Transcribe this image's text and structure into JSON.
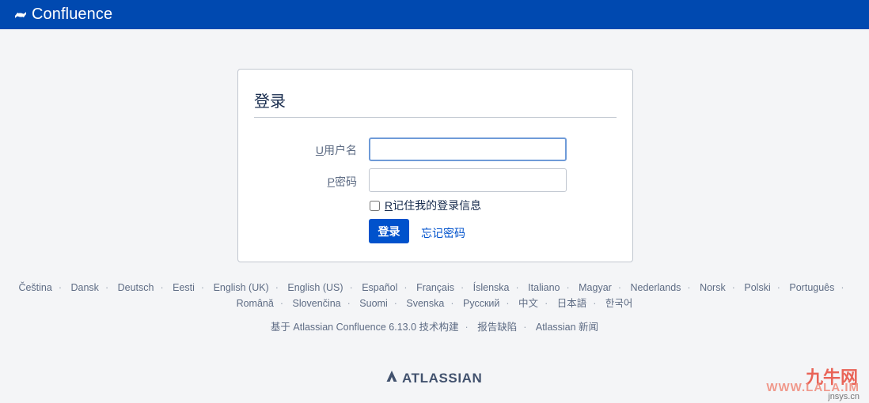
{
  "header": {
    "brand_name": "Confluence",
    "brand_color": "#0049b0",
    "logo_icon": "confluence-logo-icon"
  },
  "login": {
    "title": "登录",
    "username_label_key": "U",
    "username_label": "用户名",
    "username_value": "",
    "password_label_key": "P",
    "password_label": "密码",
    "password_value": "",
    "remember_key": "R",
    "remember_label": "记住我的登录信息",
    "remember_checked": false,
    "submit_label": "登录",
    "forgot_label": "忘记密码",
    "accent_color": "#0052cc"
  },
  "languages": {
    "row1": [
      "Čeština",
      "Dansk",
      "Deutsch",
      "Eesti",
      "English (UK)",
      "English (US)",
      "Español",
      "Français",
      "Íslenska",
      "Italiano",
      "Magyar",
      "Nederlands",
      "Norsk",
      "Polski",
      "Português"
    ],
    "row2": [
      "Română",
      "Slovenčina",
      "Suomi",
      "Svenska",
      "Русский",
      "中文",
      "日本語",
      "한국어"
    ]
  },
  "footer": {
    "powered_by": "基于 Atlassian Confluence 6.13.0 技术构建",
    "report_bug": "报告缺陷",
    "news": "Atlassian 新闻"
  },
  "atlassian": {
    "logo_text": "ATLASSIAN",
    "logo_icon": "atlassian-logo-icon"
  },
  "watermark": {
    "line1": "九牛网",
    "line2": "WWW.LALA.IM",
    "line3": "jnsys.cn"
  }
}
